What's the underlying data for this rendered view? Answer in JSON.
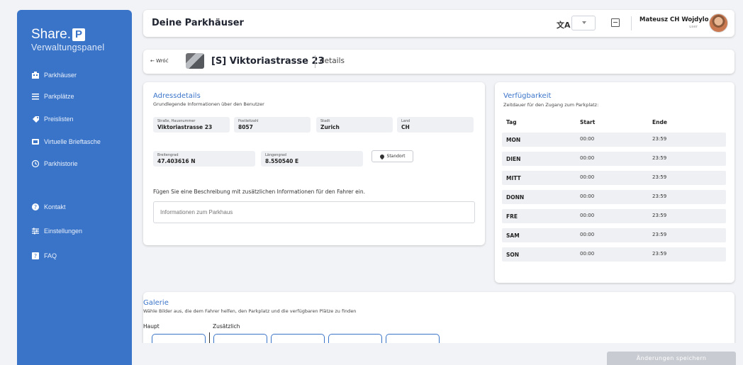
{
  "sidebar": {
    "logo": "Share.",
    "logo_p": "P",
    "subtitle": "Verwaltungspanel",
    "items": [
      {
        "label": "Parkhäuser",
        "icon": "building-icon"
      },
      {
        "label": "Parkplätze",
        "icon": "list-icon"
      },
      {
        "label": "Preislisten",
        "icon": "tag-icon"
      },
      {
        "label": "Virtuelle Brieftasche",
        "icon": "wallet-icon"
      },
      {
        "label": "Parkhistorie",
        "icon": "history-icon"
      },
      {
        "label": "Kontakt",
        "icon": "help-icon"
      },
      {
        "label": "Einstellungen",
        "icon": "sliders-icon"
      },
      {
        "label": "FAQ",
        "icon": "faq-icon"
      }
    ]
  },
  "header": {
    "title": "Deine Parkhäuser",
    "translate_glyph": "文A",
    "user_name": "Mateusz CH Wojdylo",
    "user_role": "user"
  },
  "breadcrumb": {
    "back": "← Wróć",
    "name": "[S] Viktoriastrasse 23",
    "details": "details"
  },
  "address": {
    "title": "Adressdetails",
    "subtitle": "Grundlegende Informationen über den Benutzer",
    "street_label": "Straße, Hausnummer",
    "street": "Viktoriastrasse 23",
    "zip_label": "Postleitzahl",
    "zip": "8057",
    "city_label": "Stadt",
    "city": "Zurich",
    "country_label": "Land",
    "country": "CH",
    "lat_label": "Breitengrad",
    "lat": "47.403616 N",
    "lon_label": "Längengrad",
    "lon": "8.550540 E",
    "location_button": "Standort",
    "description_hint": "Fügen Sie eine Beschreibung mit zusätzlichen Informationen für den Fahrer ein.",
    "description_placeholder": "Informationen zum Parkhaus"
  },
  "availability": {
    "title": "Verfügbarkeit",
    "subtitle": "Zeitdauer für den Zugang zum Parkplatz:",
    "headers": {
      "day": "Tag",
      "start": "Start",
      "end": "Ende"
    },
    "rows": [
      {
        "day": "MON",
        "start": "00:00",
        "end": "23:59"
      },
      {
        "day": "DIEN",
        "start": "00:00",
        "end": "23:59"
      },
      {
        "day": "MITT",
        "start": "00:00",
        "end": "23:59"
      },
      {
        "day": "DONN",
        "start": "00:00",
        "end": "23:59"
      },
      {
        "day": "FRE",
        "start": "00:00",
        "end": "23:59"
      },
      {
        "day": "SAM",
        "start": "00:00",
        "end": "23:59"
      },
      {
        "day": "SON",
        "start": "00:00",
        "end": "23:59"
      }
    ]
  },
  "gallery": {
    "title": "Galerie",
    "subtitle": "Wähle Bilder aus, die dem Fahrer helfen, den Parkplatz und die verfügbaren Plätze zu finden",
    "tab_main": "Haupt",
    "tab_extra": "Zusätzlich"
  },
  "save_button": "Änderungen speichern",
  "colors": {
    "accent": "#3a74c8",
    "disabled": "#c8cbd1"
  }
}
